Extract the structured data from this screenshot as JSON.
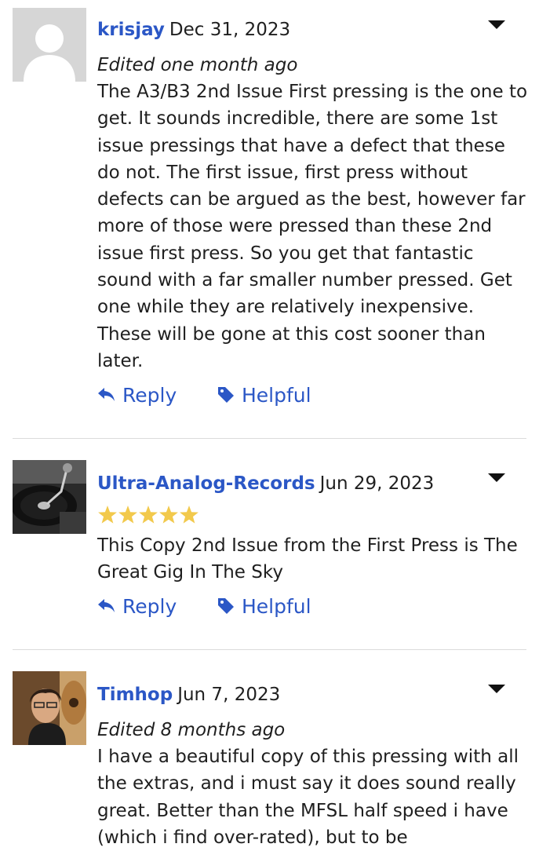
{
  "reviews": [
    {
      "username": "krisjay",
      "date": "Dec 31, 2023",
      "edited": "Edited one month ago",
      "body": "The A3/B3 2nd Issue First pressing is the one to get. It sounds incredible, there are some 1st issue pressings that have a defect that these do not. The first issue, first press without defects can be argued as the best, however far more of those were pressed than these 2nd issue first press. So you get that fantastic sound with a far smaller number pressed. Get one while they are relatively inexpensive. These will be gone at this cost sooner than later.",
      "reply_label": "Reply",
      "helpful_label": "Helpful",
      "avatar_icon": "default-user-icon"
    },
    {
      "username": "Ultra-Analog-Records",
      "date": "Jun 29, 2023",
      "rating": 5,
      "rating_max": 5,
      "body": "This Copy 2nd Issue from the First Press is The Great Gig In The Sky",
      "reply_label": "Reply",
      "helpful_label": "Helpful",
      "avatar_icon": "turntable-photo"
    },
    {
      "username": "Timhop",
      "date": "Jun 7, 2023",
      "edited": "Edited 8 months ago",
      "body": "I have a beautiful copy of this pressing with all the extras, and i must say it does sound really great. Better than the MFSL half speed i have (which i find over-rated), but to be",
      "avatar_icon": "man-with-guitar-photo"
    }
  ],
  "colors": {
    "link": "#2b57c6",
    "text": "#1f1f1f",
    "star": "#f2c94c",
    "divider": "#dcdcdc"
  }
}
